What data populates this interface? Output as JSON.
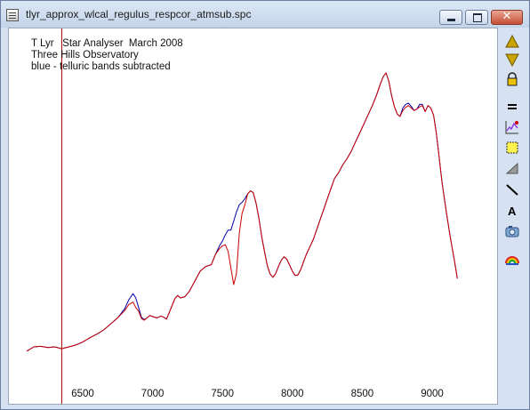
{
  "window": {
    "title": "tlyr_approx_wlcal_regulus_respcor_atmsub.spc"
  },
  "plot": {
    "header_lines": [
      "T Lyr   Star Analyser  March 2008",
      "Three Hills Observatory",
      "blue - telluric bands subtracted"
    ]
  },
  "chart_data": {
    "type": "line",
    "x_tick_labels": [
      "6500",
      "7000",
      "7500",
      "8000",
      "8500",
      "9000"
    ],
    "xlim": [
      6100,
      9450
    ],
    "marker_line_x": 6350,
    "series": [
      {
        "color": "#0000aa",
        "x": [
          6100,
          6150,
          6200,
          6250,
          6300,
          6350,
          6400,
          6450,
          6500,
          6550,
          6600,
          6650,
          6700,
          6750,
          6800,
          6830,
          6860,
          6880,
          6900,
          6920,
          6940,
          6960,
          6980,
          7000,
          7030,
          7060,
          7080,
          7100,
          7130,
          7160,
          7180,
          7200,
          7230,
          7260,
          7300,
          7340,
          7380,
          7420,
          7450,
          7480,
          7500,
          7520,
          7540,
          7560,
          7580,
          7600,
          7620,
          7640,
          7660,
          7680,
          7700,
          7720,
          7740,
          7760,
          7780,
          7800,
          7820,
          7840,
          7860,
          7880,
          7900,
          7920,
          7940,
          7960,
          7980,
          8000,
          8020,
          8040,
          8060,
          8080,
          8100,
          8120,
          8150,
          8180,
          8210,
          8240,
          8270,
          8300,
          8330,
          8360,
          8390,
          8420,
          8450,
          8480,
          8510,
          8540,
          8570,
          8600,
          8630,
          8650,
          8670,
          8690,
          8710,
          8730,
          8750,
          8770,
          8790,
          8810,
          8830,
          8850,
          8870,
          8890,
          8910,
          8930,
          8950,
          8970,
          8990,
          9010,
          9030,
          9050,
          9070,
          9100,
          9130,
          9160,
          9180
        ],
        "y": [
          40,
          47,
          48,
          46,
          47,
          44,
          47,
          50,
          55,
          62,
          68,
          75,
          85,
          95,
          110,
          125,
          135,
          128,
          112,
          96,
          92,
          95,
          99,
          97,
          95,
          98,
          96,
          93,
          110,
          127,
          132,
          128,
          130,
          138,
          155,
          172,
          180,
          183,
          200,
          215,
          222,
          232,
          240,
          240,
          255,
          270,
          282,
          286,
          292,
          300,
          305,
          302,
          285,
          260,
          230,
          205,
          182,
          168,
          162,
          168,
          180,
          190,
          196,
          192,
          182,
          172,
          165,
          166,
          175,
          188,
          200,
          210,
          225,
          245,
          265,
          285,
          305,
          325,
          335,
          348,
          358,
          370,
          385,
          400,
          415,
          430,
          445,
          462,
          482,
          494,
          500,
          486,
          462,
          444,
          432,
          428,
          442,
          448,
          450,
          445,
          438,
          440,
          448,
          448,
          436,
          446,
          442,
          430,
          400,
          360,
          320,
          272,
          228,
          188,
          160
        ],
        "values_note": "relative intensity"
      },
      {
        "color": "#cc0000",
        "x": [
          6100,
          6150,
          6200,
          6250,
          6300,
          6350,
          6400,
          6450,
          6500,
          6550,
          6600,
          6650,
          6700,
          6750,
          6800,
          6830,
          6860,
          6880,
          6900,
          6920,
          6940,
          6960,
          6980,
          7000,
          7030,
          7060,
          7080,
          7100,
          7130,
          7160,
          7180,
          7200,
          7230,
          7260,
          7300,
          7340,
          7380,
          7420,
          7450,
          7480,
          7500,
          7520,
          7540,
          7560,
          7580,
          7600,
          7620,
          7640,
          7660,
          7680,
          7700,
          7720,
          7740,
          7760,
          7780,
          7800,
          7820,
          7840,
          7860,
          7880,
          7900,
          7920,
          7940,
          7960,
          7980,
          8000,
          8020,
          8040,
          8060,
          8080,
          8100,
          8120,
          8150,
          8180,
          8210,
          8240,
          8270,
          8300,
          8330,
          8360,
          8390,
          8420,
          8450,
          8480,
          8510,
          8540,
          8570,
          8600,
          8630,
          8650,
          8670,
          8690,
          8710,
          8730,
          8750,
          8770,
          8790,
          8810,
          8830,
          8850,
          8870,
          8890,
          8910,
          8930,
          8950,
          8970,
          8990,
          9010,
          9030,
          9050,
          9070,
          9100,
          9130,
          9160,
          9180
        ],
        "y": [
          40,
          47,
          48,
          46,
          47,
          44,
          47,
          50,
          55,
          62,
          68,
          75,
          85,
          95,
          107,
          117,
          121,
          112,
          106,
          94,
          91,
          95,
          99,
          97,
          95,
          98,
          96,
          93,
          110,
          127,
          132,
          128,
          130,
          138,
          155,
          172,
          180,
          183,
          200,
          210,
          214,
          216,
          205,
          178,
          150,
          168,
          235,
          268,
          282,
          300,
          305,
          302,
          285,
          260,
          230,
          205,
          182,
          168,
          162,
          168,
          180,
          190,
          196,
          192,
          182,
          172,
          165,
          166,
          175,
          188,
          200,
          210,
          225,
          245,
          265,
          285,
          305,
          325,
          335,
          348,
          358,
          370,
          385,
          400,
          415,
          430,
          445,
          462,
          482,
          494,
          500,
          486,
          462,
          444,
          432,
          428,
          438,
          443,
          446,
          442,
          438,
          440,
          444,
          446,
          436,
          446,
          442,
          430,
          400,
          360,
          320,
          272,
          228,
          188,
          160
        ]
      }
    ]
  },
  "toolbar": {
    "items": [
      "scroll-up-icon",
      "scroll-down-icon",
      "lock-icon",
      "equals-icon",
      "spectrum-edit-icon",
      "select-region-icon",
      "fill-icon",
      "draw-line-icon",
      "text-tool-icon",
      "camera-icon",
      "rainbow-icon"
    ],
    "text_tool_glyph": "A"
  }
}
